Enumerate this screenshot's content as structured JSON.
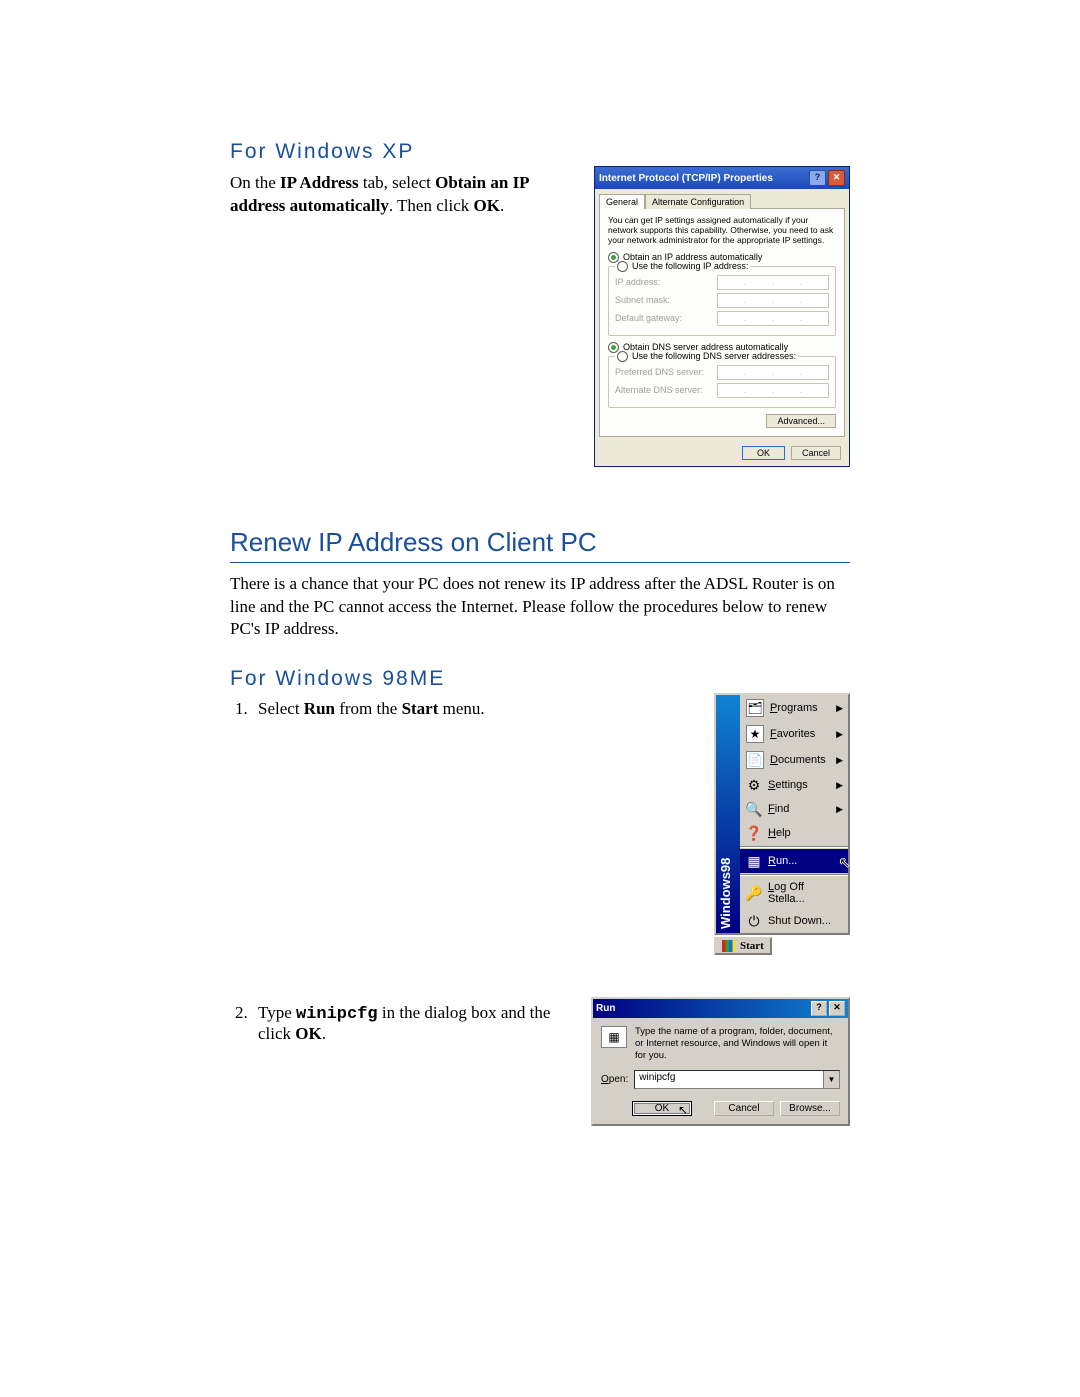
{
  "sections": {
    "xp_heading": "For Windows XP",
    "xp_para_1a": "On the ",
    "xp_para_1b": "IP Address",
    "xp_para_1c": " tab, select ",
    "xp_para_1d": "Obtain an IP address automatically",
    "xp_para_1e": ". Then click ",
    "xp_para_1f": "OK",
    "xp_para_1g": ".",
    "renew_heading": "Renew IP Address on Client PC",
    "renew_para": "There is a chance that your PC does not renew its IP address after the ADSL Router is on line and the PC cannot access the Internet. Please follow the procedures below to renew PC's IP address.",
    "w98_heading": "For Windows 98ME",
    "step1_a": "Select ",
    "step1_b": "Run",
    "step1_c": " from the ",
    "step1_d": "Start",
    "step1_e": " menu.",
    "step2_a": "Type ",
    "step2_b": "winipcfg",
    "step2_c": " in the dialog box and the click ",
    "step2_d": "OK",
    "step2_e": "."
  },
  "xp_dialog": {
    "title": "Internet Protocol (TCP/IP) Properties",
    "tabs": {
      "general": "General",
      "alt": "Alternate Configuration"
    },
    "desc": "You can get IP settings assigned automatically if your network supports this capability. Otherwise, you need to ask your network administrator for the appropriate IP settings.",
    "radio_auto_ip": "Obtain an IP address automatically",
    "radio_static_ip": "Use the following IP address:",
    "fields": {
      "ip": "IP address:",
      "mask": "Subnet mask:",
      "gw": "Default gateway:",
      "pref_dns": "Preferred DNS server:",
      "alt_dns": "Alternate DNS server:"
    },
    "radio_auto_dns": "Obtain DNS server address automatically",
    "radio_static_dns": "Use the following DNS server addresses:",
    "btn_advanced": "Advanced...",
    "btn_ok": "OK",
    "btn_cancel": "Cancel"
  },
  "start_menu": {
    "stripe": "Windows98",
    "items": {
      "programs": "Programs",
      "favorites": "Favorites",
      "documents": "Documents",
      "settings": "Settings",
      "find": "Find",
      "help": "Help",
      "run": "Run...",
      "logoff": "Log Off Stella...",
      "shutdown": "Shut Down..."
    },
    "start_button": "Start"
  },
  "run_dialog": {
    "title": "Run",
    "desc": "Type the name of a program, folder, document, or Internet resource, and Windows will open it for you.",
    "open_label": "Open:",
    "open_value": "winipcfg",
    "btn_ok": "OK",
    "btn_cancel": "Cancel",
    "btn_browse": "Browse..."
  }
}
